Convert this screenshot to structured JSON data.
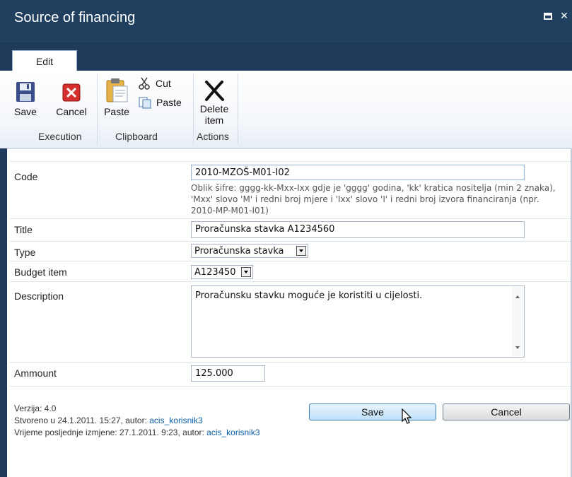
{
  "window": {
    "title": "Source of financing"
  },
  "ribbon": {
    "tab": "Edit",
    "buttons": {
      "save": "Save",
      "cancel": "Cancel",
      "paste_big": "Paste",
      "cut": "Cut",
      "paste_small": "Paste",
      "delete_line1": "Delete",
      "delete_line2": "item"
    },
    "groups": {
      "execution": "Execution",
      "clipboard": "Clipboard",
      "actions": "Actions"
    }
  },
  "form": {
    "code": {
      "label": "Code",
      "value": "2010-MZOŠ-M01-I02",
      "help": "Oblik šifre: gggg-kk-Mxx-Ixx gdje je 'gggg' godina, 'kk' kratica nositelja (min 2 znaka), 'Mxx' slovo 'M' i redni broj mjere i 'Ixx' slovo 'I' i redni broj izvora financiranja (npr. 2010-MP-M01-I01)"
    },
    "title": {
      "label": "Title",
      "value": "Proračunska stavka A1234560"
    },
    "type": {
      "label": "Type",
      "value": "Proračunska stavka"
    },
    "budget_item": {
      "label": "Budget item",
      "value": "A123450"
    },
    "description": {
      "label": "Description",
      "value": "Proračunsku stavku moguće je koristiti u cijelosti."
    },
    "amount": {
      "label": "Ammount",
      "value": "125.000"
    }
  },
  "footer": {
    "version": "Verzija: 4.0",
    "created_prefix": "Stvoreno u 24.1.2011. 15:27, autor: ",
    "created_author": "acis_korisnik3",
    "modified_prefix": "Vrijeme posljednje izmjene: 27.1.2011. 9:23, autor: ",
    "modified_author": "acis_korisnik3",
    "save_label": "Save",
    "cancel_label": "Cancel"
  },
  "colors": {
    "titlebar": "#21405f",
    "link": "#0a5ea8",
    "save_icon": "#3a4e8c",
    "cancel_icon": "#d62d2d"
  }
}
